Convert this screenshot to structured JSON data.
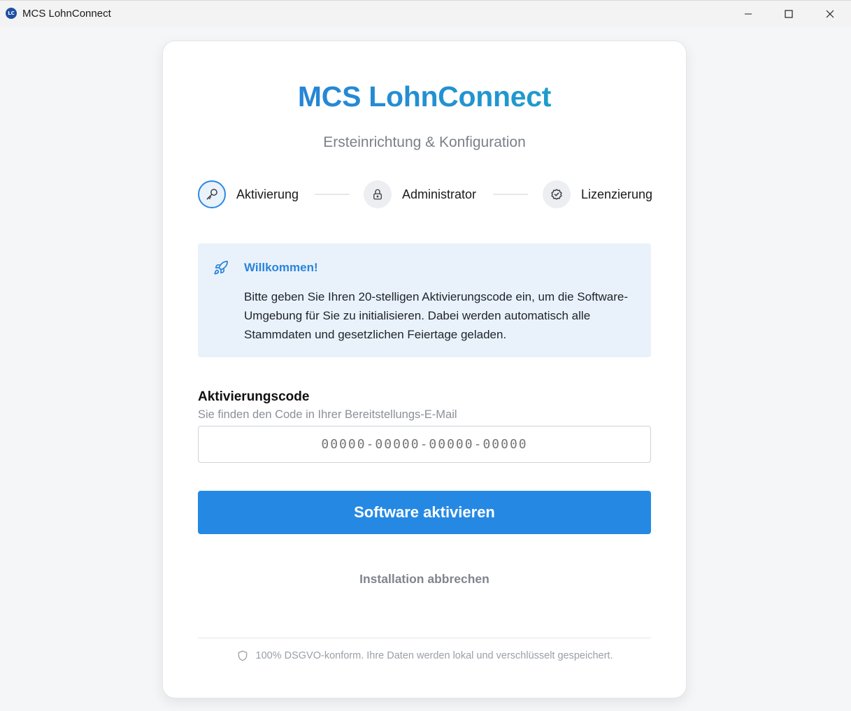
{
  "window": {
    "title": "MCS LohnConnect",
    "icon_label": "LC",
    "controls": [
      "minimize-icon",
      "maximize-icon",
      "close-icon"
    ]
  },
  "header": {
    "brand": "MCS LohnConnect",
    "subtitle": "Ersteinrichtung & Konfiguration"
  },
  "steps": [
    {
      "label": "Aktivierung",
      "icon": "key-icon",
      "active": true
    },
    {
      "label": "Administrator",
      "icon": "lock-icon",
      "active": false
    },
    {
      "label": "Lizenzierung",
      "icon": "badge-check-icon",
      "active": false
    }
  ],
  "info": {
    "icon": "rocket-icon",
    "title": "Willkommen!",
    "text": "Bitte geben Sie Ihren 20-stelligen Aktivierungscode ein, um die Software-Umgebung für Sie zu initialisieren. Dabei werden automatisch alle Stammdaten und gesetzlichen Feiertage geladen."
  },
  "activation": {
    "label": "Aktivierungscode",
    "hint": "Sie finden den Code in Ihrer Bereitstellungs-E-Mail",
    "placeholder": "00000-00000-00000-00000",
    "value": ""
  },
  "actions": {
    "activate_label": "Software aktivieren",
    "cancel_label": "Installation abbrechen"
  },
  "footer": {
    "icon": "shield-icon",
    "text": "100% DSGVO-konform. Ihre Daten werden lokal und verschlüsselt gespeichert."
  },
  "colors": {
    "accent": "#2589e4",
    "brand_gradient_start": "#2b78dc",
    "brand_gradient_end": "#1ba8c7",
    "info_bg": "#e9f2fb"
  }
}
